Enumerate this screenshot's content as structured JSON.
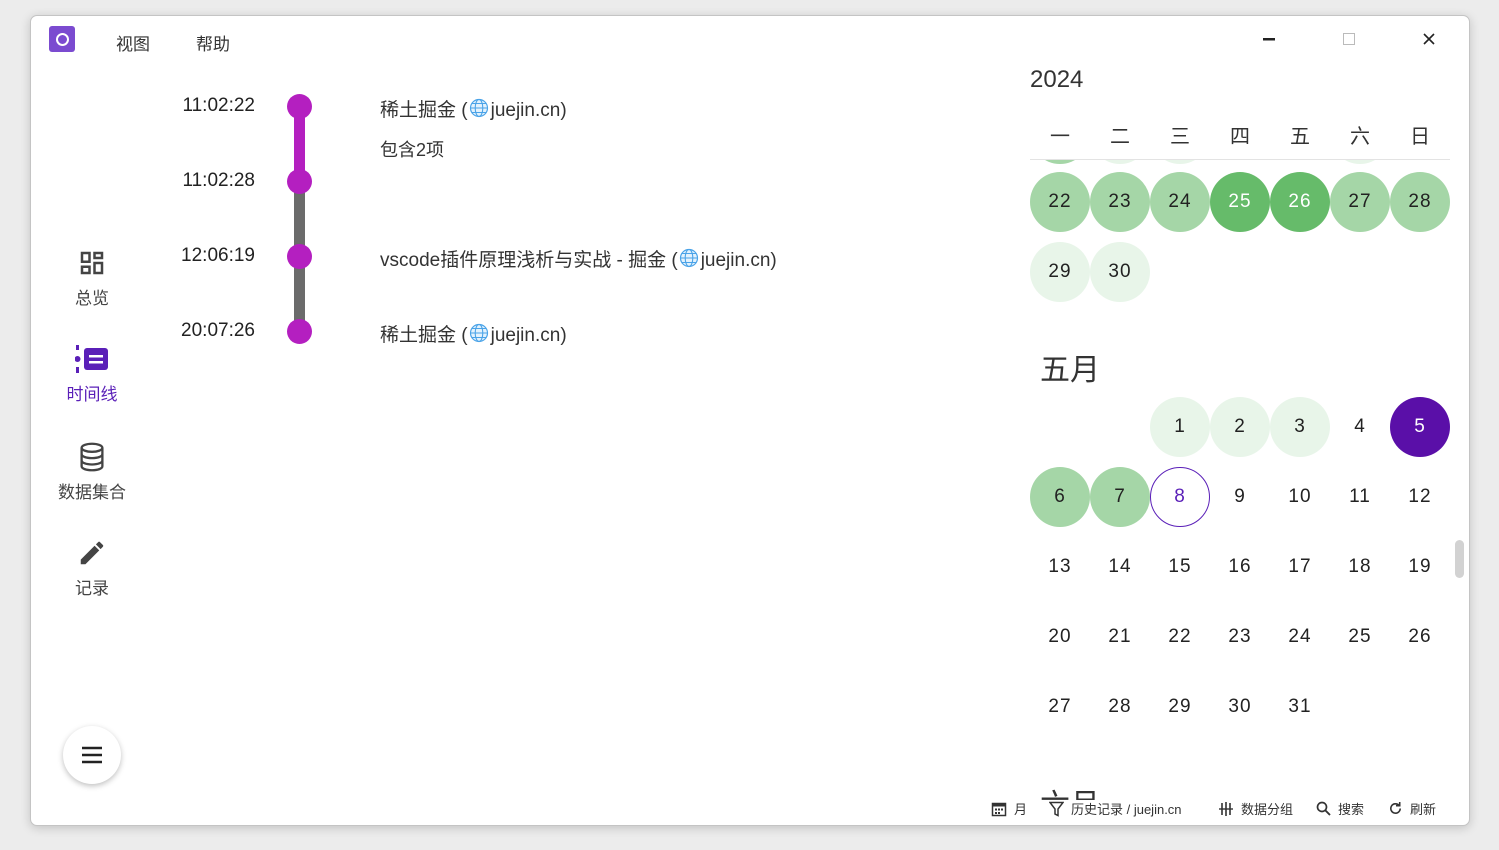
{
  "menu": {
    "view": "视图",
    "help": "帮助"
  },
  "sidebar": {
    "items": [
      {
        "label": "总览",
        "icon": "dashboard-icon"
      },
      {
        "label": "时间线",
        "icon": "timeline-icon",
        "active": true
      },
      {
        "label": "数据集合",
        "icon": "database-icon"
      },
      {
        "label": "记录",
        "icon": "pencil-icon"
      }
    ],
    "menu_fab_icon": "menu-icon"
  },
  "timeline": {
    "times": [
      "11:02:22",
      "11:02:28",
      "12:06:19",
      "20:07:26"
    ],
    "entries": [
      {
        "title": "稀土掘金 (",
        "domain": "juejin.cn",
        "close": ")",
        "sub": "包含2项"
      },
      {
        "title": "vscode插件原理浅析与实战 - 掘金 (",
        "domain": "juejin.cn",
        "close": ")"
      },
      {
        "title": "稀土掘金 (",
        "domain": "juejin.cn",
        "close": ")"
      }
    ]
  },
  "calendar": {
    "year": "2024",
    "weekdays": [
      "一",
      "二",
      "三",
      "四",
      "五",
      "六",
      "日"
    ],
    "april_tail": [
      "22",
      "23",
      "24",
      "25",
      "26",
      "27",
      "28",
      "29",
      "30"
    ],
    "may_title": "五月",
    "may_days": [
      "1",
      "2",
      "3",
      "4",
      "5",
      "6",
      "7",
      "8",
      "9",
      "10",
      "11",
      "12",
      "13",
      "14",
      "15",
      "16",
      "17",
      "18",
      "19",
      "20",
      "21",
      "22",
      "23",
      "24",
      "25",
      "26",
      "27",
      "28",
      "29",
      "30",
      "31"
    ],
    "next_month_title": "六月",
    "colors": {
      "low": "#e8f5e9",
      "mid": "#a5d6a7",
      "high": "#66bb6a",
      "selected": "#5a0fa8",
      "today_ring": "#5a1fb8"
    }
  },
  "statusbar": {
    "month": "月",
    "history": "历史记录 / juejin.cn",
    "group": "数据分组",
    "search": "搜索",
    "refresh": "刷新"
  }
}
